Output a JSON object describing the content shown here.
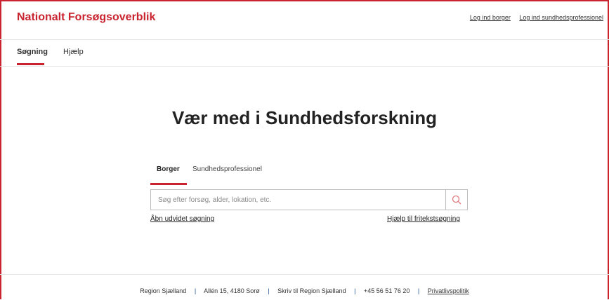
{
  "header": {
    "brand": "Nationalt Forsøgsoverblik",
    "login_citizen": "Log ind borger",
    "login_professional": "Log ind sundhedsprofessionel"
  },
  "nav": {
    "tabs": [
      {
        "label": "Søgning",
        "active": true
      },
      {
        "label": "Hjælp",
        "active": false
      }
    ]
  },
  "main": {
    "title": "Vær med i Sundhedsforskning",
    "search_tabs": [
      {
        "label": "Borger",
        "active": true
      },
      {
        "label": "Sundhedsprofessionel",
        "active": false
      }
    ],
    "search": {
      "placeholder": "Søg efter forsøg, alder, lokation, etc.",
      "value": "",
      "button_icon": "search-icon"
    },
    "advanced_link": "Åbn udvidet søgning",
    "help_link": "Hjælp til fritekstsøgning"
  },
  "footer": {
    "region": "Region Sjælland",
    "address": "Allén 15, 4180 Sorø",
    "write": "Skriv til Region Sjælland",
    "phone": "+45 56 51 76 20",
    "privacy": "Privatlivspolitik",
    "separator": "|"
  },
  "colors": {
    "accent": "#c8232e",
    "footer_separator": "#1b4f8a"
  }
}
